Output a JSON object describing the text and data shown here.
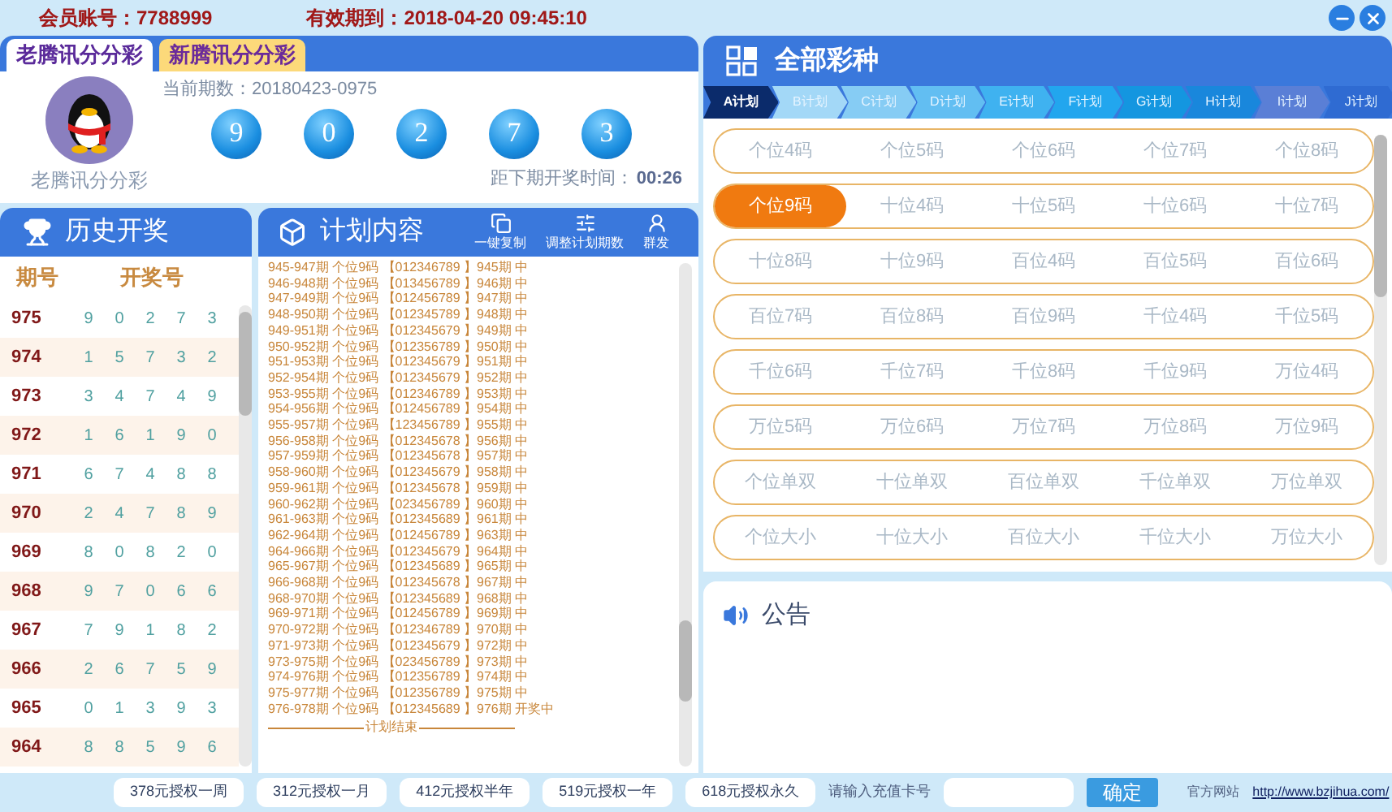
{
  "title_bar": {
    "account": "会员账号：7788999",
    "expiry": "有效期到：2018-04-20 09:45:10"
  },
  "game_tabs": [
    {
      "label": "老腾讯分分彩",
      "selected": true
    },
    {
      "label": "新腾讯分分彩",
      "selected": false
    }
  ],
  "current": {
    "avatar_caption": "老腾讯分分彩",
    "period": "当前期数：20180423-0975",
    "balls": [
      "9",
      "0",
      "2",
      "7",
      "3"
    ],
    "countdown_label": "距下期开奖时间：",
    "countdown": "00:26"
  },
  "history": {
    "title": "历史开奖",
    "columns": [
      "期号",
      "开奖号"
    ],
    "rows": [
      {
        "period": "975",
        "numbers": [
          "9",
          "0",
          "2",
          "7",
          "3"
        ]
      },
      {
        "period": "974",
        "numbers": [
          "1",
          "5",
          "7",
          "3",
          "2"
        ]
      },
      {
        "period": "973",
        "numbers": [
          "3",
          "4",
          "7",
          "4",
          "9"
        ]
      },
      {
        "period": "972",
        "numbers": [
          "1",
          "6",
          "1",
          "9",
          "0"
        ]
      },
      {
        "period": "971",
        "numbers": [
          "6",
          "7",
          "4",
          "8",
          "8"
        ]
      },
      {
        "period": "970",
        "numbers": [
          "2",
          "4",
          "7",
          "8",
          "9"
        ]
      },
      {
        "period": "969",
        "numbers": [
          "8",
          "0",
          "8",
          "2",
          "0"
        ]
      },
      {
        "period": "968",
        "numbers": [
          "9",
          "7",
          "0",
          "6",
          "6"
        ]
      },
      {
        "period": "967",
        "numbers": [
          "7",
          "9",
          "1",
          "8",
          "2"
        ]
      },
      {
        "period": "966",
        "numbers": [
          "2",
          "6",
          "7",
          "5",
          "9"
        ]
      },
      {
        "period": "965",
        "numbers": [
          "0",
          "1",
          "3",
          "9",
          "3"
        ]
      },
      {
        "period": "964",
        "numbers": [
          "8",
          "8",
          "5",
          "9",
          "6"
        ]
      }
    ]
  },
  "plan": {
    "title": "计划内容",
    "tools": [
      "一键复制",
      "调整计划期数",
      "群发"
    ],
    "lines": [
      "945-947期 个位9码 【012346789 】945期 中",
      "946-948期 个位9码 【013456789 】946期 中",
      "947-949期 个位9码 【012456789 】947期 中",
      "948-950期 个位9码 【012345789 】948期 中",
      "949-951期 个位9码 【012345679 】949期 中",
      "950-952期 个位9码 【012356789 】950期 中",
      "951-953期 个位9码 【012345679 】951期 中",
      "952-954期 个位9码 【012345679 】952期 中",
      "953-955期 个位9码 【012346789 】953期 中",
      "954-956期 个位9码 【012456789 】954期 中",
      "955-957期 个位9码 【123456789 】955期 中",
      "956-958期 个位9码 【012345678 】956期 中",
      "957-959期 个位9码 【012345678 】957期 中",
      "958-960期 个位9码 【012345679 】958期 中",
      "959-961期 个位9码 【012345678 】959期 中",
      "960-962期 个位9码 【023456789 】960期 中",
      "961-963期 个位9码 【012345689 】961期 中",
      "962-964期 个位9码 【012456789 】963期 中",
      "964-966期 个位9码 【012345679 】964期 中",
      "965-967期 个位9码 【012345689 】965期 中",
      "966-968期 个位9码 【012345678 】967期 中",
      "968-970期 个位9码 【012345689 】968期 中",
      "969-971期 个位9码 【012456789 】969期 中",
      "970-972期 个位9码 【012346789 】970期 中",
      "971-973期 个位9码 【012345679 】972期 中",
      "973-975期 个位9码 【023456789 】973期 中",
      "974-976期 个位9码 【012356789 】974期 中",
      "975-977期 个位9码 【012356789 】975期 中",
      "976-978期 个位9码 【012345689 】976期 开奖中"
    ],
    "footer": "计划结束"
  },
  "all_types": {
    "title": "全部彩种",
    "plan_tabs": [
      {
        "label": "A计划",
        "selected": true,
        "color": "#0b2b6b"
      },
      {
        "label": "B计划",
        "selected": false,
        "color": "#a3d8f7"
      },
      {
        "label": "C计划",
        "selected": false,
        "color": "#86ccf4"
      },
      {
        "label": "D计划",
        "selected": false,
        "color": "#62bef2"
      },
      {
        "label": "E计划",
        "selected": false,
        "color": "#3fb2f0"
      },
      {
        "label": "F计划",
        "selected": false,
        "color": "#22a6ee"
      },
      {
        "label": "G计划",
        "selected": false,
        "color": "#1496e0"
      },
      {
        "label": "H计划",
        "selected": false,
        "color": "#1987dc"
      },
      {
        "label": "I计划",
        "selected": false,
        "color": "#5a7fd6"
      },
      {
        "label": "J计划",
        "selected": false,
        "color": "#2f6bd2"
      }
    ],
    "rows": [
      {
        "items": [
          {
            "label": "个位4码",
            "selected": false
          },
          {
            "label": "个位5码",
            "selected": false
          },
          {
            "label": "个位6码",
            "selected": false
          },
          {
            "label": "个位7码",
            "selected": false
          },
          {
            "label": "个位8码",
            "selected": false
          }
        ]
      },
      {
        "items": [
          {
            "label": "个位9码",
            "selected": true
          },
          {
            "label": "十位4码",
            "selected": false
          },
          {
            "label": "十位5码",
            "selected": false
          },
          {
            "label": "十位6码",
            "selected": false
          },
          {
            "label": "十位7码",
            "selected": false
          }
        ]
      },
      {
        "items": [
          {
            "label": "十位8码",
            "selected": false
          },
          {
            "label": "十位9码",
            "selected": false
          },
          {
            "label": "百位4码",
            "selected": false
          },
          {
            "label": "百位5码",
            "selected": false
          },
          {
            "label": "百位6码",
            "selected": false
          }
        ]
      },
      {
        "items": [
          {
            "label": "百位7码",
            "selected": false
          },
          {
            "label": "百位8码",
            "selected": false
          },
          {
            "label": "百位9码",
            "selected": false
          },
          {
            "label": "千位4码",
            "selected": false
          },
          {
            "label": "千位5码",
            "selected": false
          }
        ]
      },
      {
        "items": [
          {
            "label": "千位6码",
            "selected": false
          },
          {
            "label": "千位7码",
            "selected": false
          },
          {
            "label": "千位8码",
            "selected": false
          },
          {
            "label": "千位9码",
            "selected": false
          },
          {
            "label": "万位4码",
            "selected": false
          }
        ]
      },
      {
        "items": [
          {
            "label": "万位5码",
            "selected": false
          },
          {
            "label": "万位6码",
            "selected": false
          },
          {
            "label": "万位7码",
            "selected": false
          },
          {
            "label": "万位8码",
            "selected": false
          },
          {
            "label": "万位9码",
            "selected": false
          }
        ]
      },
      {
        "items": [
          {
            "label": "个位单双",
            "selected": false
          },
          {
            "label": "十位单双",
            "selected": false
          },
          {
            "label": "百位单双",
            "selected": false
          },
          {
            "label": "千位单双",
            "selected": false
          },
          {
            "label": "万位单双",
            "selected": false
          }
        ]
      },
      {
        "items": [
          {
            "label": "个位大小",
            "selected": false
          },
          {
            "label": "十位大小",
            "selected": false
          },
          {
            "label": "百位大小",
            "selected": false
          },
          {
            "label": "千位大小",
            "selected": false
          },
          {
            "label": "万位大小",
            "selected": false
          }
        ]
      }
    ]
  },
  "notice": {
    "title": "公告"
  },
  "footer_bar": {
    "plans": [
      "378元授权一周",
      "312元授权一月",
      "412元授权半年",
      "519元授权一年",
      "618元授权永久"
    ],
    "card_label": "请输入充值卡号",
    "confirm": "确定",
    "site_label": "官方网站",
    "site_url": "http://www.bzjihua.com/"
  }
}
